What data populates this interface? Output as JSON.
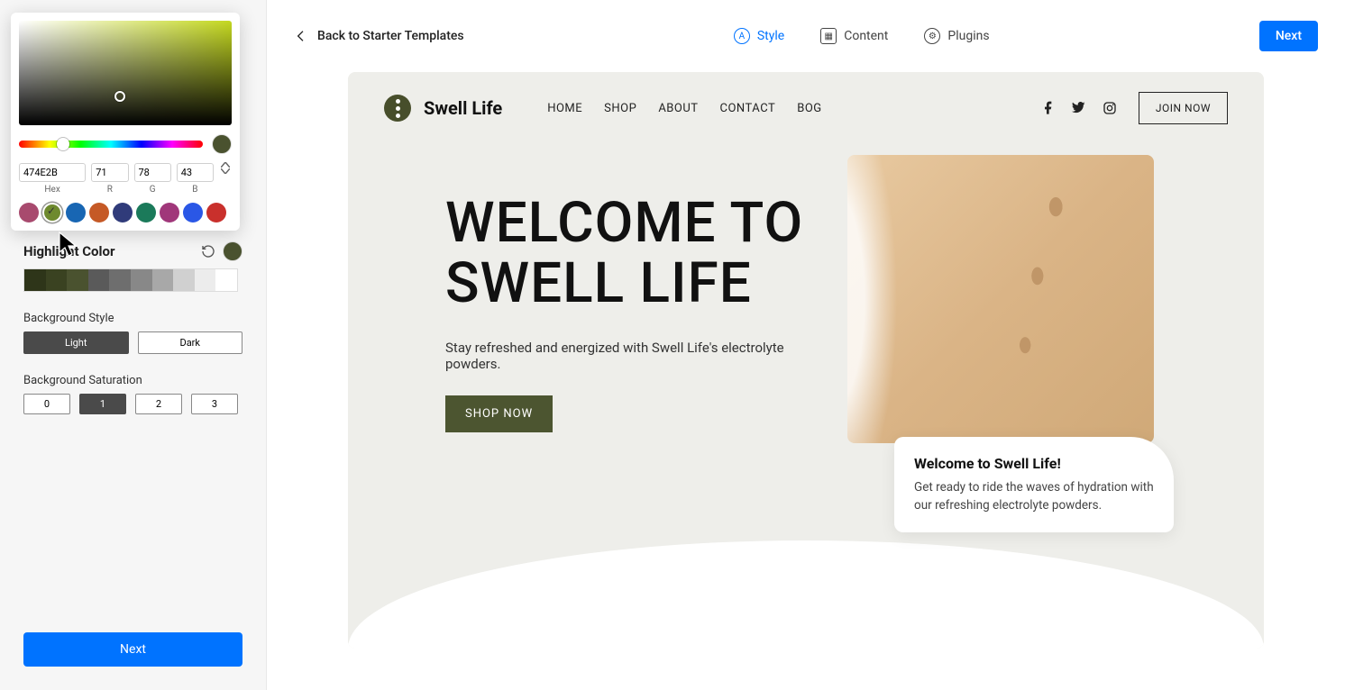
{
  "topbar": {
    "back": "Back to Starter Templates",
    "nav": {
      "style": "Style",
      "content": "Content",
      "plugins": "Plugins"
    },
    "next": "Next"
  },
  "picker": {
    "hex": "474E2B",
    "r": "71",
    "g": "78",
    "b": "43",
    "labels": {
      "hex": "Hex",
      "r": "R",
      "g": "G",
      "b": "B"
    },
    "current": "#4a522f",
    "swatches": [
      "#a84a6e",
      "#6e8a2e",
      "#1866b3",
      "#c55926",
      "#303b7a",
      "#1b7a5a",
      "#a0377a",
      "#2a57e6",
      "#c9302c"
    ]
  },
  "sidebar": {
    "highlight_label": "Highlight Color",
    "palette": [
      "#2e3519",
      "#3a4221",
      "#4a522f",
      "#5a5a5a",
      "#6e6e6e",
      "#888888",
      "#a8a8a8",
      "#d0d0d0",
      "#ececec",
      "#ffffff"
    ],
    "bg_style_label": "Background Style",
    "bg_style": {
      "light": "Light",
      "dark": "Dark"
    },
    "bg_sat_label": "Background Saturation",
    "bg_sat": [
      "0",
      "1",
      "2",
      "3"
    ],
    "next": "Next"
  },
  "preview": {
    "brand": "Swell Life",
    "menu": [
      "HOME",
      "SHOP",
      "ABOUT",
      "CONTACT",
      "BOG"
    ],
    "join": "JOIN NOW",
    "hero_title": "WELCOME TO SWELL LIFE",
    "hero_sub": "Stay refreshed and energized with Swell Life's electrolyte powders.",
    "shop": "SHOP NOW",
    "card_title": "Welcome to Swell Life!",
    "card_body": "Get ready to ride the waves of hydration with our refreshing electrolyte powders."
  }
}
